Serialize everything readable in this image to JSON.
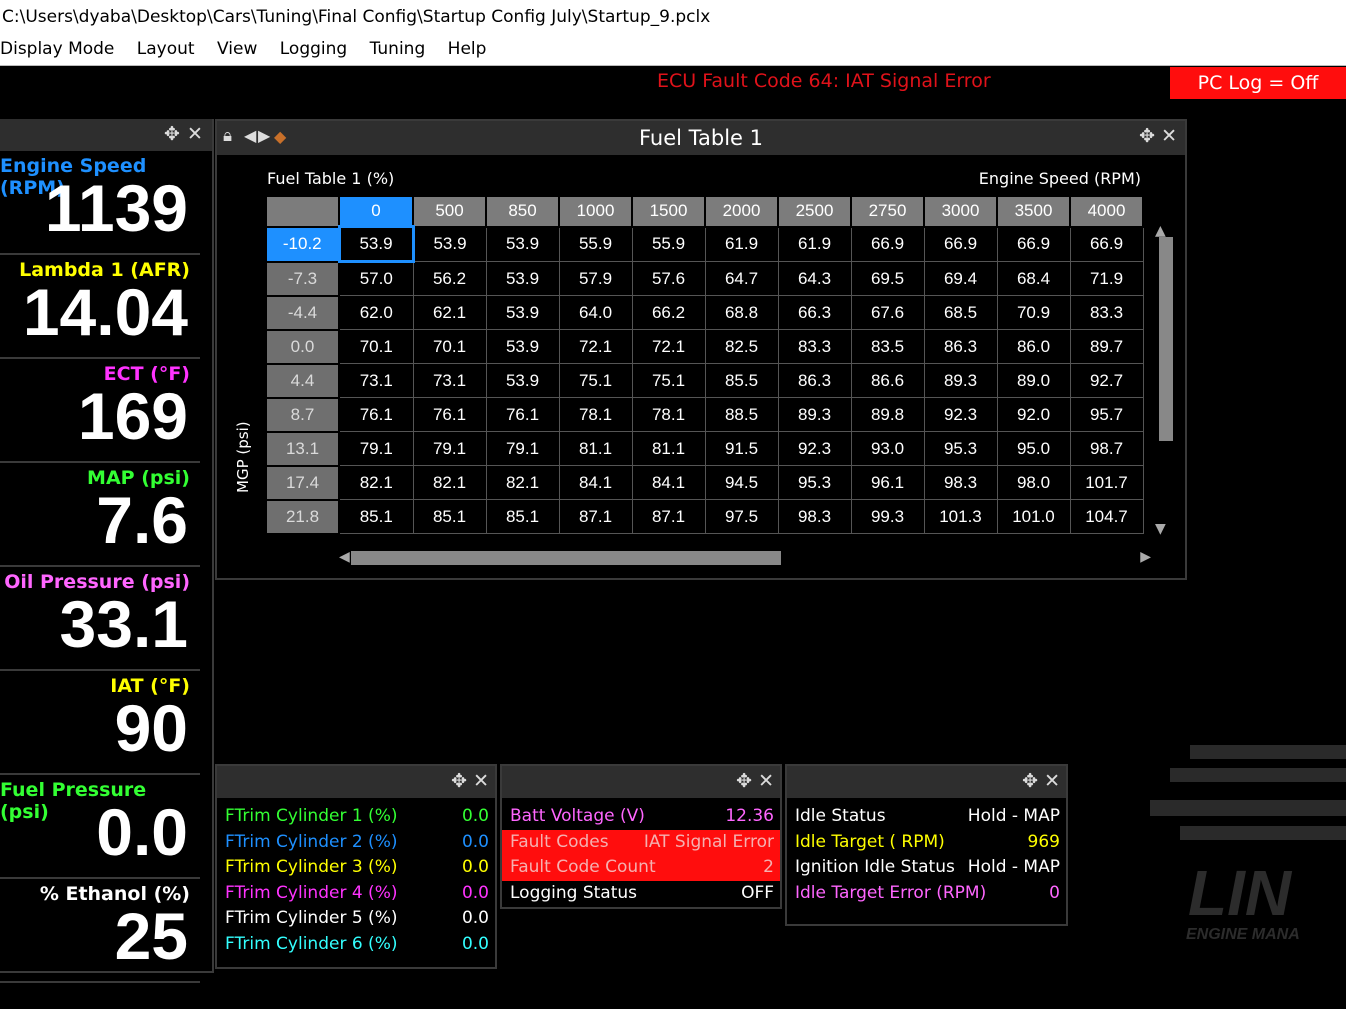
{
  "window": {
    "path": "C:\\Users\\dyaba\\Desktop\\Cars\\Tuning\\Final Config\\Startup Config July\\Startup_9.pclx"
  },
  "menu": [
    "Display Mode",
    "Layout",
    "View",
    "Logging",
    "Tuning",
    "Help"
  ],
  "status": {
    "fault_message": "ECU Fault Code 64: IAT Signal Error",
    "pc_log": "PC Log = Off"
  },
  "gauges": [
    {
      "label": "Engine Speed (RPM)",
      "value": "1139",
      "color": "#1e90ff"
    },
    {
      "label": "Lambda 1 (AFR)",
      "value": "14.04",
      "color": "#ffff00"
    },
    {
      "label": "ECT (°F)",
      "value": "169",
      "color": "#ff33ff"
    },
    {
      "label": "MAP (psi)",
      "value": "7.6",
      "color": "#33ff33"
    },
    {
      "label": "Oil Pressure (psi)",
      "value": "33.1",
      "color": "#ff66ff"
    },
    {
      "label": "IAT (°F)",
      "value": "90",
      "color": "#ffff00"
    },
    {
      "label": "Fuel Pressure (psi)",
      "value": "0.0",
      "color": "#33ff33"
    },
    {
      "label": "% Ethanol (%)",
      "value": "25",
      "color": "#ffffff"
    }
  ],
  "fuel_table": {
    "title": "Fuel Table 1",
    "table_label": "Fuel Table 1 (%)",
    "x_axis_label": "Engine Speed (RPM)",
    "y_axis_label": "MGP (psi)",
    "columns": [
      "0",
      "500",
      "850",
      "1000",
      "1500",
      "2000",
      "2500",
      "2750",
      "3000",
      "3500",
      "4000"
    ],
    "rows": [
      {
        "mgp": "-10.2",
        "values": [
          "53.9",
          "53.9",
          "53.9",
          "55.9",
          "55.9",
          "61.9",
          "61.9",
          "66.9",
          "66.9",
          "66.9",
          "66.9"
        ]
      },
      {
        "mgp": "-7.3",
        "values": [
          "57.0",
          "56.2",
          "53.9",
          "57.9",
          "57.6",
          "64.7",
          "64.3",
          "69.5",
          "69.4",
          "68.4",
          "71.9"
        ]
      },
      {
        "mgp": "-4.4",
        "values": [
          "62.0",
          "62.1",
          "53.9",
          "64.0",
          "66.2",
          "68.8",
          "66.3",
          "67.6",
          "68.5",
          "70.9",
          "83.3"
        ]
      },
      {
        "mgp": "0.0",
        "values": [
          "70.1",
          "70.1",
          "53.9",
          "72.1",
          "72.1",
          "82.5",
          "83.3",
          "83.5",
          "86.3",
          "86.0",
          "89.7"
        ]
      },
      {
        "mgp": "4.4",
        "values": [
          "73.1",
          "73.1",
          "53.9",
          "75.1",
          "75.1",
          "85.5",
          "86.3",
          "86.6",
          "89.3",
          "89.0",
          "92.7"
        ]
      },
      {
        "mgp": "8.7",
        "values": [
          "76.1",
          "76.1",
          "76.1",
          "78.1",
          "78.1",
          "88.5",
          "89.3",
          "89.8",
          "92.3",
          "92.0",
          "95.7"
        ]
      },
      {
        "mgp": "13.1",
        "values": [
          "79.1",
          "79.1",
          "79.1",
          "81.1",
          "81.1",
          "91.5",
          "92.3",
          "93.0",
          "95.3",
          "95.0",
          "98.7"
        ]
      },
      {
        "mgp": "17.4",
        "values": [
          "82.1",
          "82.1",
          "82.1",
          "84.1",
          "84.1",
          "94.5",
          "95.3",
          "96.1",
          "98.3",
          "98.0",
          "101.7"
        ]
      },
      {
        "mgp": "21.8",
        "values": [
          "85.1",
          "85.1",
          "85.1",
          "87.1",
          "87.1",
          "97.5",
          "98.3",
          "99.3",
          "101.3",
          "101.0",
          "104.7"
        ]
      }
    ]
  },
  "ftrim_panel": [
    {
      "label": "FTrim Cylinder 1 (%)",
      "value": "0.0",
      "color": "#33ff33"
    },
    {
      "label": "FTrim Cylinder 2 (%)",
      "value": "0.0",
      "color": "#1e90ff"
    },
    {
      "label": "FTrim Cylinder 3 (%)",
      "value": "0.0",
      "color": "#ffff00"
    },
    {
      "label": "FTrim Cylinder 4 (%)",
      "value": "0.0",
      "color": "#ff33ff"
    },
    {
      "label": "FTrim Cylinder 5 (%)",
      "value": "0.0",
      "color": "#ffffff"
    },
    {
      "label": "FTrim Cylinder 6 (%)",
      "value": "0.0",
      "color": "#33ffff"
    }
  ],
  "status_panel": [
    {
      "label": "Batt Voltage (V)",
      "value": "12.36",
      "color": "#ff66ff",
      "bg": ""
    },
    {
      "label": "Fault Codes",
      "value": "IAT Signal Error",
      "color": "#f5b0b0",
      "bg": "#ff0d0d"
    },
    {
      "label": "Fault Code Count",
      "value": "2",
      "color": "#f5b0b0",
      "bg": "#ff0d0d"
    },
    {
      "label": "Logging Status",
      "value": "OFF",
      "color": "#ffffff",
      "bg": ""
    }
  ],
  "idle_panel": [
    {
      "label": "Idle Status",
      "value": "Hold - MAP",
      "color": "#ffffff"
    },
    {
      "label": "Idle Target ( RPM)",
      "value": "969",
      "color": "#ffff00"
    },
    {
      "label": "Ignition Idle Status",
      "value": "Hold - MAP",
      "color": "#ffffff"
    },
    {
      "label": "Idle Target Error (RPM)",
      "value": "0",
      "color": "#ff66ff"
    }
  ],
  "logo": {
    "text": "LIN",
    "subtext": "ENGINE MANA"
  }
}
